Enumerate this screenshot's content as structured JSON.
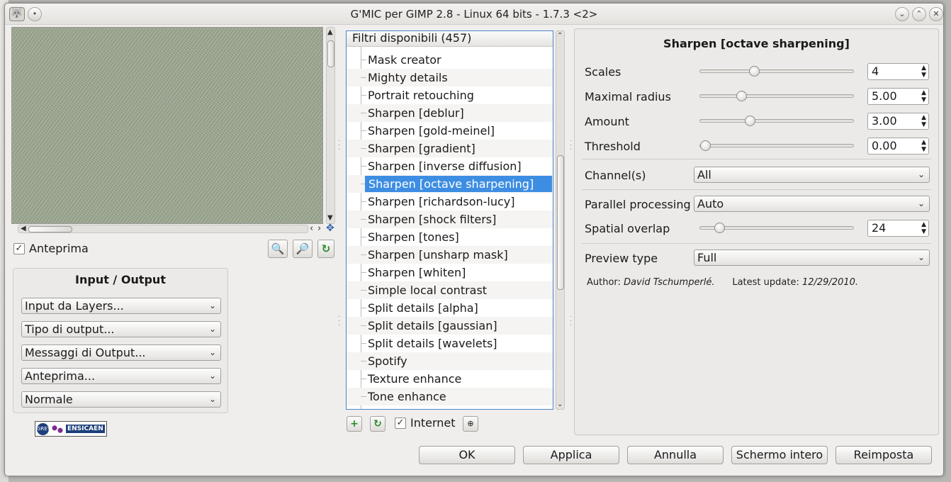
{
  "window": {
    "title": "G'MIC per GIMP 2.8 - Linux 64 bits - 1.7.3 <2>"
  },
  "preview": {
    "checkbox_label": "Anteprima",
    "checked": true
  },
  "input_output": {
    "title": "Input / Output",
    "combos": [
      "Input da Layers...",
      "Tipo di output...",
      "Messaggi di Output...",
      "Anteprima...",
      "Normale"
    ]
  },
  "logo": {
    "text": "ENSICAEN",
    "circle_text": "GREYC"
  },
  "filters": {
    "header": "Filtri disponibili (457)",
    "items": [
      "Mask creator",
      "Mighty details",
      "Portrait retouching",
      "Sharpen [deblur]",
      "Sharpen [gold-meinel]",
      "Sharpen [gradient]",
      "Sharpen [inverse diffusion]",
      "Sharpen [octave sharpening]",
      "Sharpen [richardson-lucy]",
      "Sharpen [shock filters]",
      "Sharpen [tones]",
      "Sharpen [unsharp mask]",
      "Sharpen [whiten]",
      "Simple local contrast",
      "Split details [alpha]",
      "Split details [gaussian]",
      "Split details [wavelets]",
      "Spotify",
      "Texture enhance",
      "Tone enhance"
    ],
    "selected_index": 7,
    "internet_label": "Internet",
    "internet_checked": true
  },
  "settings": {
    "title": "Sharpen [octave sharpening]",
    "params": [
      {
        "label": "Scales",
        "value": "4",
        "fraction": 0.34
      },
      {
        "label": "Maximal radius",
        "value": "5.00",
        "fraction": 0.25
      },
      {
        "label": "Amount",
        "value": "3.00",
        "fraction": 0.31
      },
      {
        "label": "Threshold",
        "value": "0.00",
        "fraction": 0.0
      }
    ],
    "channel": {
      "label": "Channel(s)",
      "value": "All"
    },
    "parallel": {
      "label": "Parallel processing",
      "value": "Auto"
    },
    "overlap": {
      "label": "Spatial overlap",
      "value": "24",
      "fraction": 0.1
    },
    "preview_type": {
      "label": "Preview type",
      "value": "Full"
    },
    "author_label": "Author:",
    "author_name": "David Tschumperlé.",
    "update_label": "Latest update:",
    "update_date": "12/29/2010."
  },
  "buttons": {
    "ok": "OK",
    "apply": "Applica",
    "cancel": "Annulla",
    "fullscreen": "Schermo intero",
    "reset": "Reimposta"
  }
}
